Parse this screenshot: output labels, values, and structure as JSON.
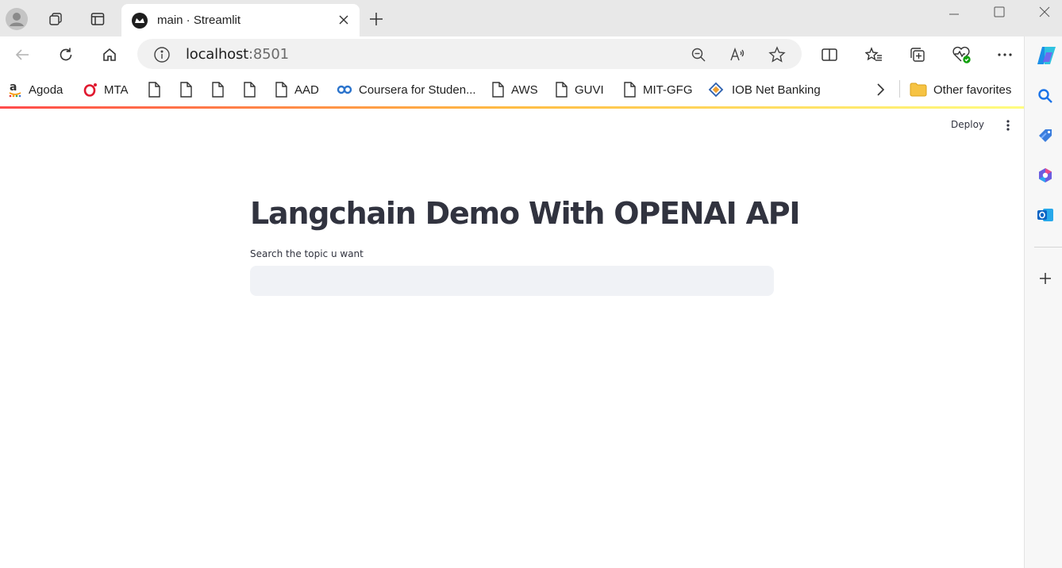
{
  "tab": {
    "title": "main · Streamlit"
  },
  "address": {
    "host": "localhost",
    "port": ":8501"
  },
  "favorites": [
    {
      "label": "Agoda",
      "icon": "amazon-icon"
    },
    {
      "label": "MTA",
      "icon": "opera-icon"
    },
    {
      "label": "",
      "icon": "page-icon"
    },
    {
      "label": "",
      "icon": "page-icon"
    },
    {
      "label": "",
      "icon": "page-icon"
    },
    {
      "label": "",
      "icon": "page-icon"
    },
    {
      "label": "AAD",
      "icon": "page-icon"
    },
    {
      "label": "Coursera for Studen...",
      "icon": "coursera-icon"
    },
    {
      "label": "AWS",
      "icon": "page-icon"
    },
    {
      "label": "GUVI",
      "icon": "page-icon"
    },
    {
      "label": "MIT-GFG",
      "icon": "page-icon"
    },
    {
      "label": "IOB Net Banking",
      "icon": "iob-icon"
    }
  ],
  "other_favorites": "Other favorites",
  "streamlit": {
    "deploy_label": "Deploy",
    "title": "Langchain Demo With OPENAI API",
    "input_label": "Search the topic u want",
    "input_value": ""
  },
  "colors": {
    "accent_gradient_start": "#ff4b4b",
    "accent_gradient_mid": "#ffbd45",
    "accent_gradient_end": "#fffd80",
    "title_text": "#31333f",
    "input_bg": "#f0f2f6"
  }
}
